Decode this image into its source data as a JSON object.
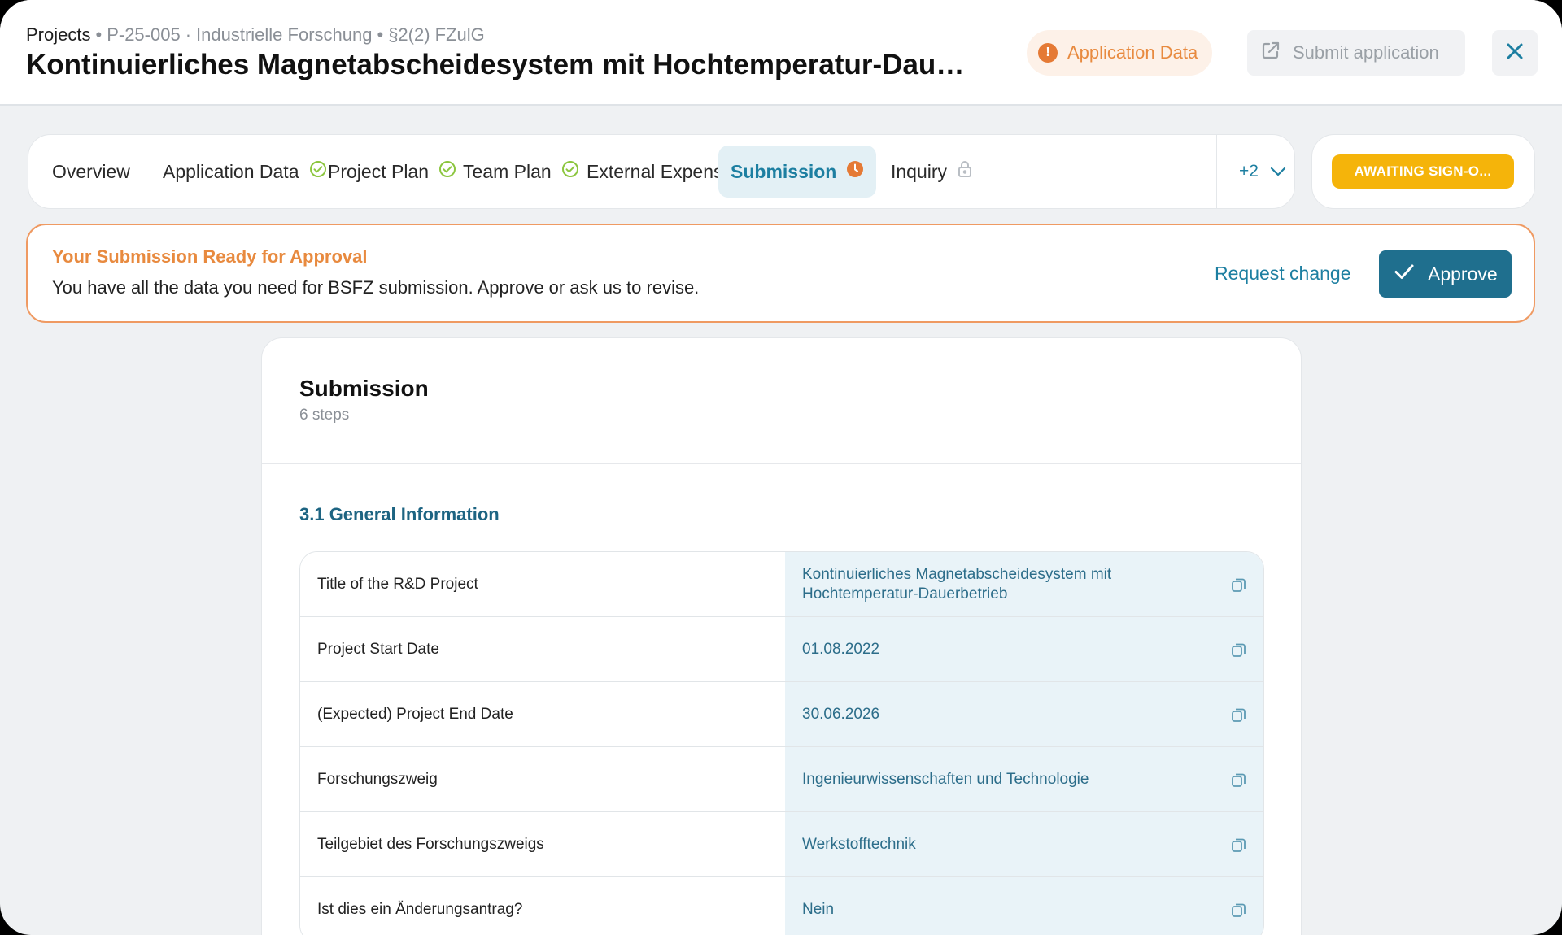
{
  "header": {
    "breadcrumb_root": "Projects",
    "breadcrumb_id": "P-25-005",
    "breadcrumb_category": "Industrielle Forschung",
    "breadcrumb_law": "§2(2) FZulG",
    "title": "Kontinuierliches Magnetabscheidesystem mit Hochtemperatur-Dauerbetrieb",
    "application_data_label": "Application Data",
    "submit_label": "Submit application"
  },
  "tabs": [
    {
      "label": "Overview",
      "status": "none"
    },
    {
      "label": "Application Data",
      "status": "done"
    },
    {
      "label": "Project Plan",
      "status": "done"
    },
    {
      "label": "Team Plan",
      "status": "done"
    },
    {
      "label": "External Expense",
      "status": "complete"
    },
    {
      "label": "Submission",
      "status": "pending"
    },
    {
      "label": "Inquiry",
      "status": "locked"
    }
  ],
  "tabs_more": "+2",
  "status_badge": "AWAITING SIGN-O...",
  "banner": {
    "title": "Your Submission Ready for Approval",
    "text": "You have all the data you need for BSFZ submission. Approve or ask us to revise.",
    "request_change": "Request change",
    "approve": "Approve"
  },
  "card": {
    "title": "Submission",
    "subtitle": "6 steps",
    "section_title": "3.1 General Information",
    "rows": [
      {
        "label": "Title of the R&D Project",
        "value": "Kontinuierliches Magnetabscheidesystem mit Hochtemperatur-Dauerbetrieb"
      },
      {
        "label": "Project Start Date",
        "value": "01.08.2022"
      },
      {
        "label": "(Expected) Project End Date",
        "value": "30.06.2026"
      },
      {
        "label": "Forschungszweig",
        "value": "Ingenieurwissenschaften und Technologie"
      },
      {
        "label": "Teilgebiet des Forschungszweigs",
        "value": "Werkstofftechnik"
      },
      {
        "label": "Ist dies ein Änderungsantrag?",
        "value": "Nein"
      }
    ]
  },
  "colors": {
    "accent": "#1d7fa1",
    "warning": "#e88a3f",
    "status_badge": "#f5b40a",
    "check_green": "#8cc63f",
    "approve_button": "#1f6f8e"
  }
}
